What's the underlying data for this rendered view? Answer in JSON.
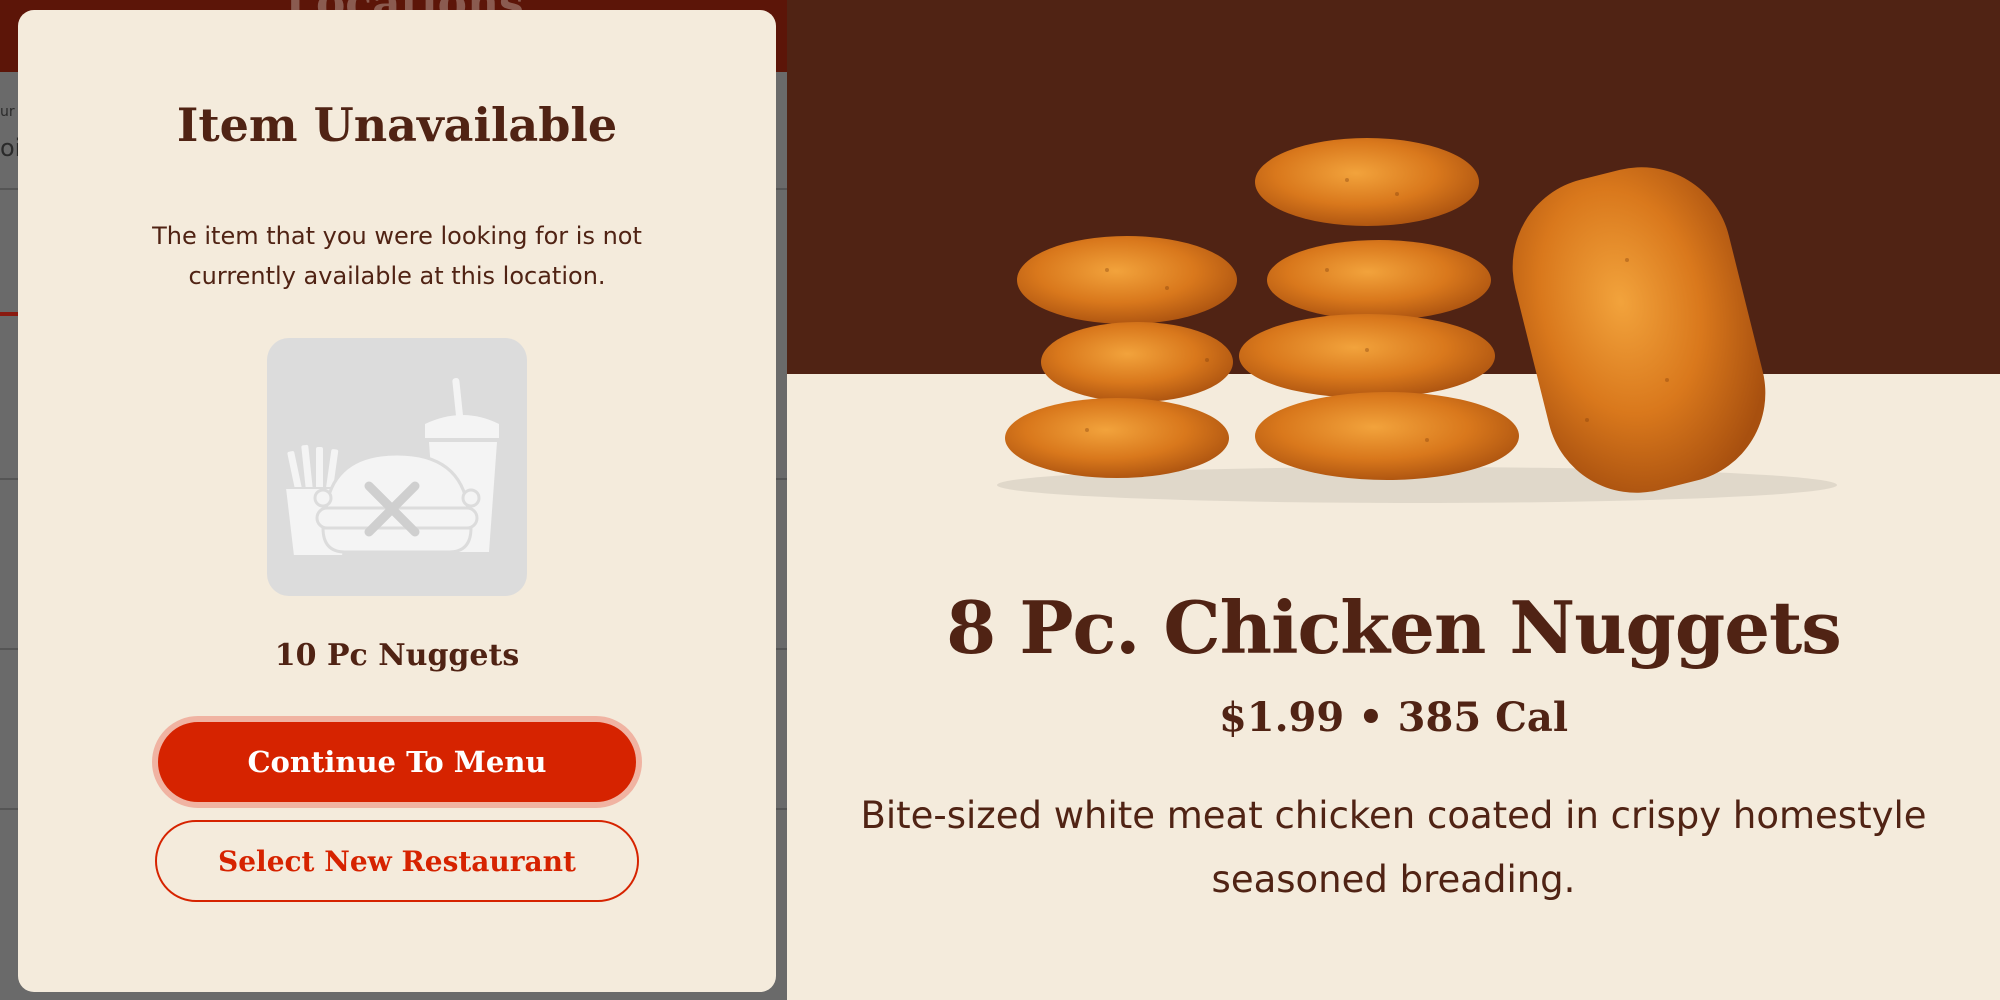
{
  "background_page": {
    "header_title": "Locations",
    "edge_text_1": "ur A",
    "edge_text_2": "ois"
  },
  "modal": {
    "title": "Item Unavailable",
    "message": "The item that you were looking for is not currently available at this location.",
    "item_name": "10 Pc Nuggets",
    "continue_label": "Continue To Menu",
    "select_label": "Select New Restaurant",
    "placeholder_icon": "unavailable-meal-icon"
  },
  "product": {
    "title": "8 Pc. Chicken Nuggets",
    "price": "$1.99",
    "separator": "•",
    "calories": "385 Cal",
    "description": "Bite-sized white meat chicken coated in crispy homestyle seasoned breading.",
    "image": "chicken-nuggets-photo"
  },
  "colors": {
    "brand_brown": "#502314",
    "brand_red": "#d62300",
    "cream": "#f4ebdc",
    "overlay_gray": "#6a6a6a"
  }
}
